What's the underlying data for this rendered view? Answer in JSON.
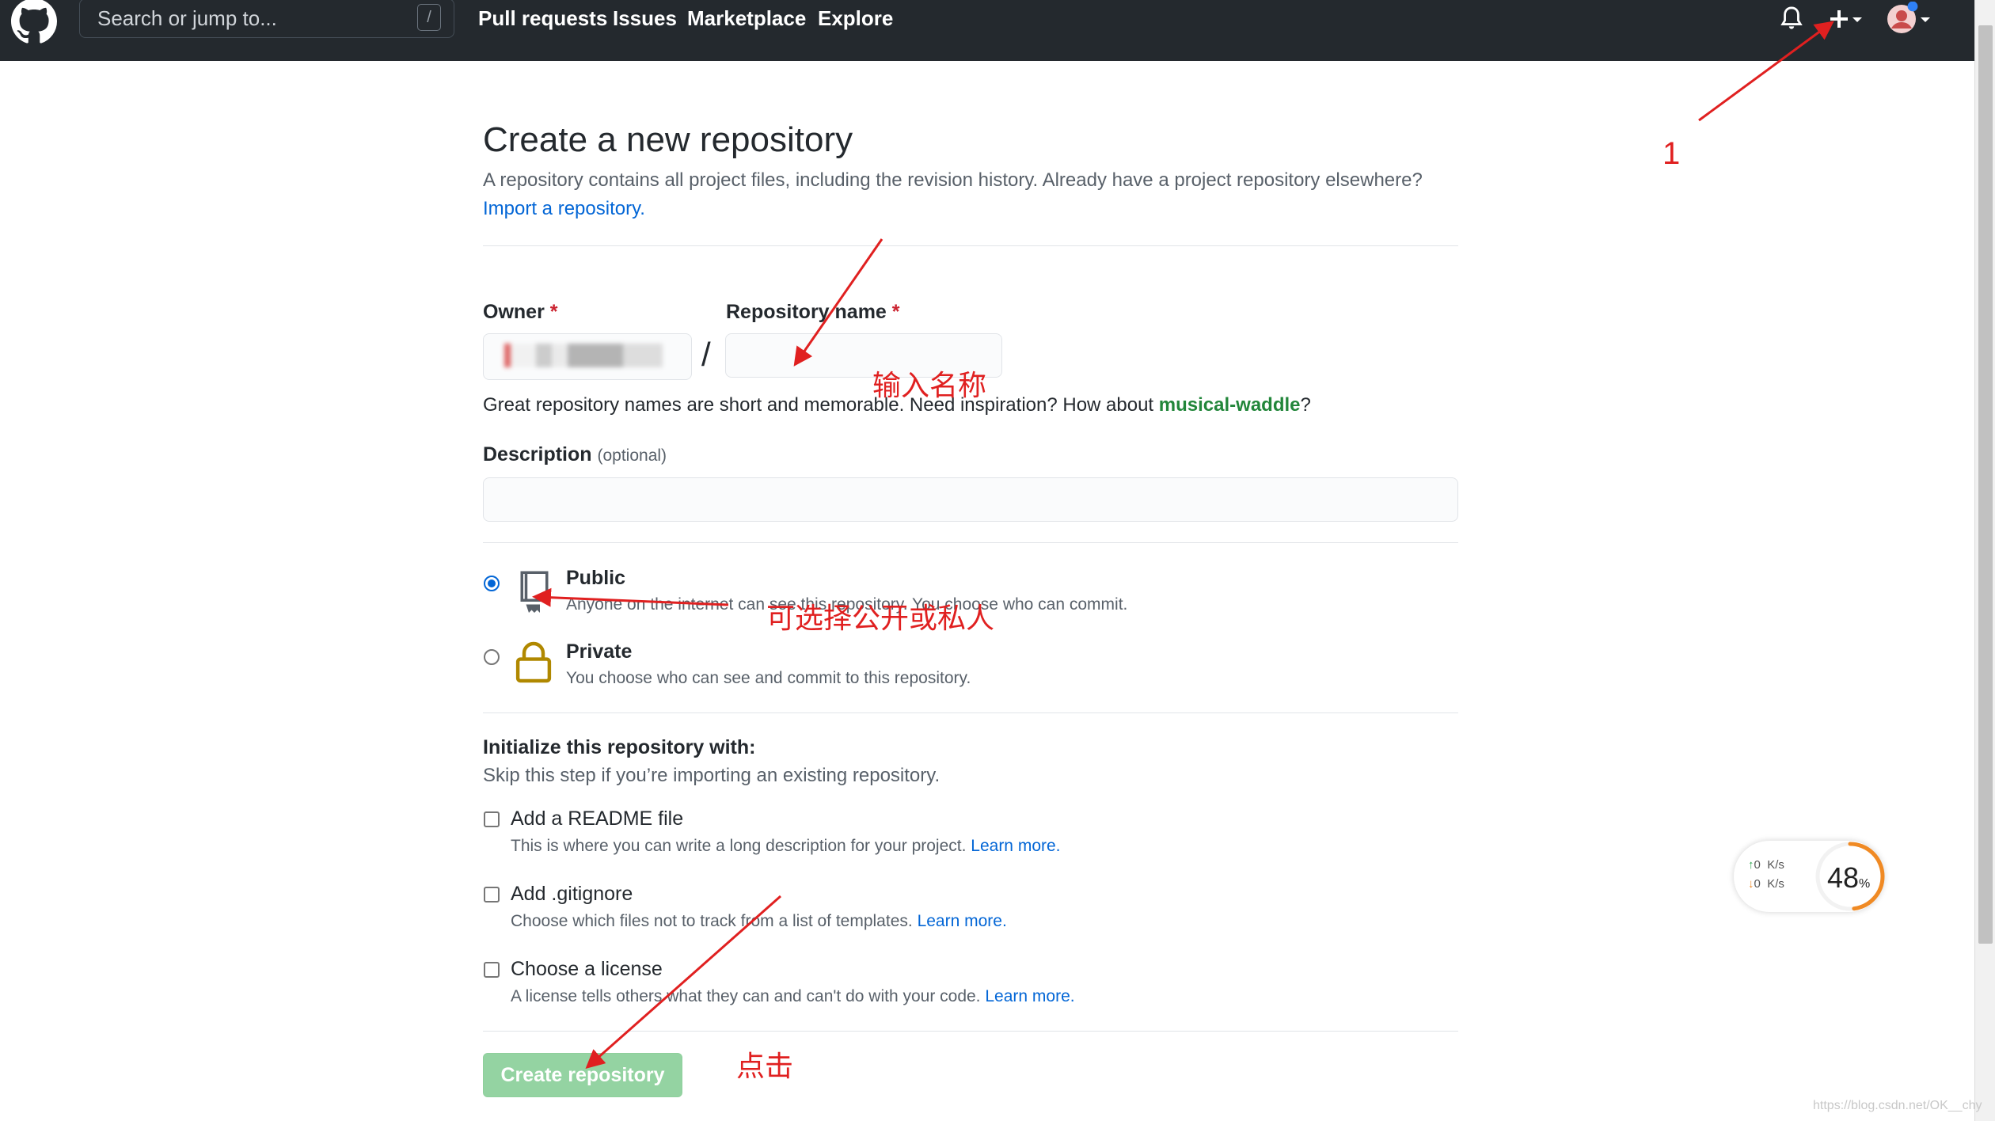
{
  "header": {
    "search_placeholder": "Search or jump to...",
    "slash_key": "/",
    "nav": [
      "Pull requests",
      "Issues",
      "Marketplace",
      "Explore"
    ]
  },
  "page": {
    "title": "Create a new repository",
    "lead": "A repository contains all project files, including the revision history. Already have a project repository elsewhere?",
    "import_link": "Import a repository.",
    "owner_label": "Owner",
    "required_mark": "*",
    "repo_label": "Repository name",
    "separator": "/",
    "hint_prefix": "Great repository names are short and memorable. Need inspiration? How about ",
    "hint_suggestion": "musical-waddle",
    "hint_suffix": "?",
    "description_label": "Description",
    "description_optional": "(optional)",
    "visibility": [
      {
        "title": "Public",
        "desc": "Anyone on the internet can see this repository. You choose who can commit.",
        "selected": true
      },
      {
        "title": "Private",
        "desc": "You choose who can see and commit to this repository.",
        "selected": false
      }
    ],
    "init_title": "Initialize this repository with:",
    "init_sub": "Skip this step if you’re importing an existing repository.",
    "init_options": [
      {
        "title": "Add a README file",
        "desc": "This is where you can write a long description for your project.",
        "link": "Learn more."
      },
      {
        "title": "Add .gitignore",
        "desc": "Choose which files not to track from a list of templates.",
        "link": "Learn more."
      },
      {
        "title": "Choose a license",
        "desc": "A license tells others what they can and can't do with your code.",
        "link": "Learn more."
      }
    ],
    "create_button": "Create repository"
  },
  "annotations": {
    "step1": "1",
    "enter_name": "输入名称",
    "choose_visibility": "可选择公开或私人",
    "click": "点击"
  },
  "widget": {
    "up": "0",
    "down": "0",
    "unit": "K/s",
    "percent_value": "48",
    "percent_sign": "%",
    "percent": 48
  },
  "watermark": "https://blog.csdn.net/OK__chy",
  "colors": {
    "header_bg": "#24292e",
    "link": "#0366d6",
    "suggestion": "#22863a",
    "button_disabled": "#94d3a2",
    "annotation": "#e02020",
    "gauge": "#f08a24"
  }
}
